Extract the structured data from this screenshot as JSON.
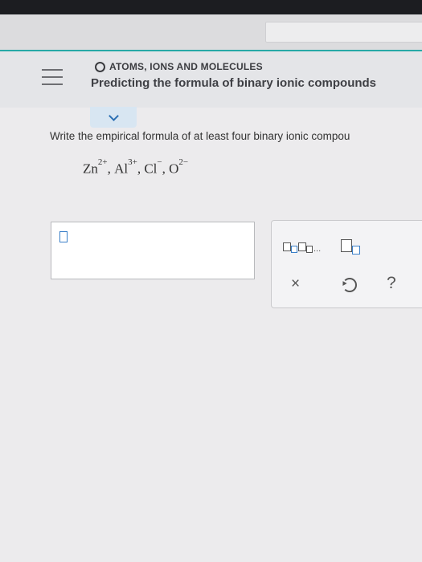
{
  "header": {
    "topic": "ATOMS, IONS AND MOLECULES",
    "title": "Predicting the formula of binary ionic compounds"
  },
  "question": {
    "prompt": "Write the empirical formula of at least four binary ionic compou",
    "ions": [
      {
        "symbol": "Zn",
        "charge": "2+",
        "sep": ", "
      },
      {
        "symbol": "Al",
        "charge": "3+",
        "sep": ", "
      },
      {
        "symbol": "Cl",
        "charge": "−",
        "sep": ", "
      },
      {
        "symbol": "O",
        "charge": "2−",
        "sep": ""
      }
    ]
  },
  "tools": {
    "close_symbol": "×",
    "help_symbol": "?",
    "subscript_ellipsis": "..."
  },
  "colors": {
    "accent": "#27a9a6",
    "link_blue": "#2b6fb3",
    "cursor_blue": "#3a7fc8"
  },
  "icons": [
    "menu-icon",
    "circle-icon",
    "chevron-down-icon",
    "subscript-icon",
    "superscript-icon",
    "close-icon",
    "undo-icon",
    "help-icon"
  ]
}
